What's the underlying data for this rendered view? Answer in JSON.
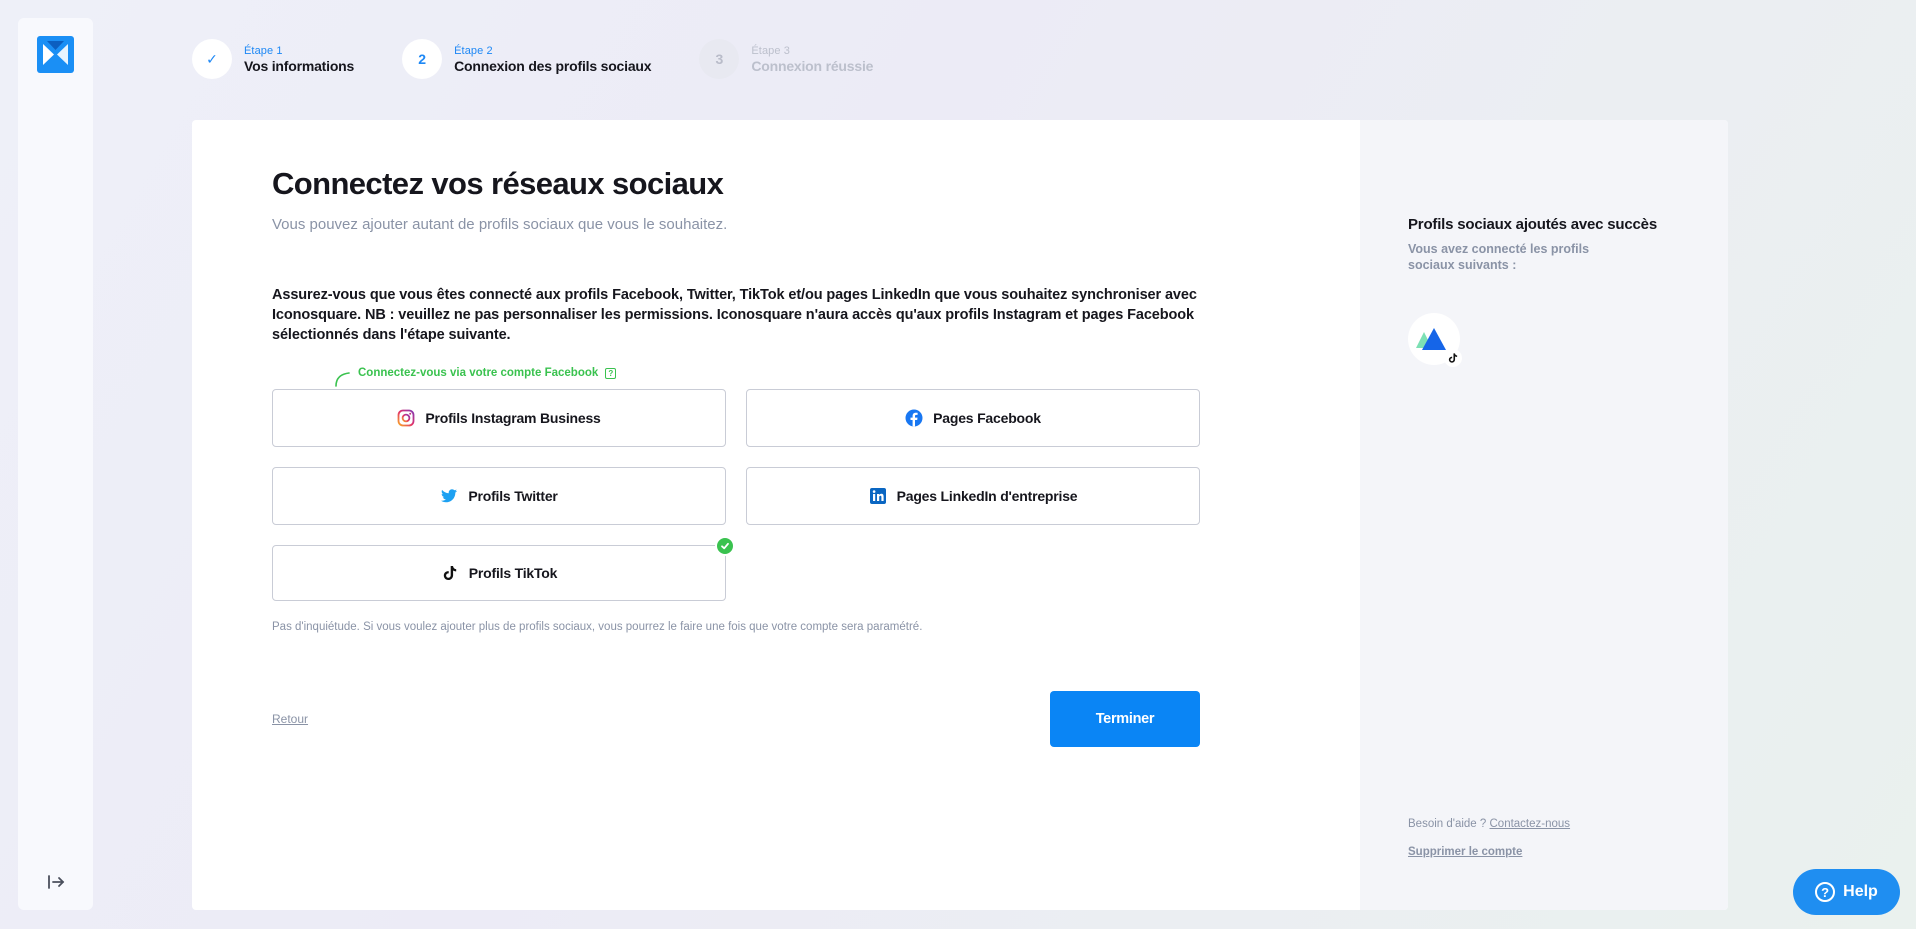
{
  "stepper": {
    "steps": [
      {
        "label": "Étape 1",
        "title": "Vos informations",
        "marker": "✓"
      },
      {
        "label": "Étape 2",
        "title": "Connexion des profils sociaux",
        "marker": "2"
      },
      {
        "label": "Étape 3",
        "title": "Connexion réussie",
        "marker": "3"
      }
    ]
  },
  "main": {
    "title": "Connectez vos réseaux sociaux",
    "subtitle": "Vous pouvez ajouter autant de profils sociaux que vous le souhaitez.",
    "instructions": "Assurez-vous que vous êtes connecté aux profils Facebook, Twitter, TikTok et/ou pages LinkedIn que vous souhaitez synchroniser avec Iconosquare. NB : veuillez ne pas personnaliser les permissions. Iconosquare n'aura accès qu'aux profils Instagram et pages Facebook sélectionnés dans l'étape suivante.",
    "fb_hint": "Connectez-vous via votre compte Facebook",
    "fb_hint_icon": "?",
    "buttons": {
      "instagram": "Profils Instagram Business",
      "facebook": "Pages Facebook",
      "twitter": "Profils Twitter",
      "linkedin": "Pages LinkedIn d'entreprise",
      "tiktok": "Profils TikTok"
    },
    "note": "Pas d'inquiétude. Si vous voulez ajouter plus de profils sociaux, vous pourrez le faire une fois que votre compte sera paramétré.",
    "back": "Retour",
    "finish": "Terminer"
  },
  "side": {
    "title": "Profils sociaux ajoutés avec succès",
    "subtitle": "Vous avez connecté les profils sociaux suivants :",
    "help_prefix": "Besoin d'aide ?",
    "contact": "Contactez-nous",
    "delete": "Supprimer le compte"
  },
  "help": {
    "label": "Help",
    "icon": "?"
  },
  "colors": {
    "accent": "#0a85f5",
    "success": "#3ac24f",
    "muted": "#8a93a6"
  }
}
